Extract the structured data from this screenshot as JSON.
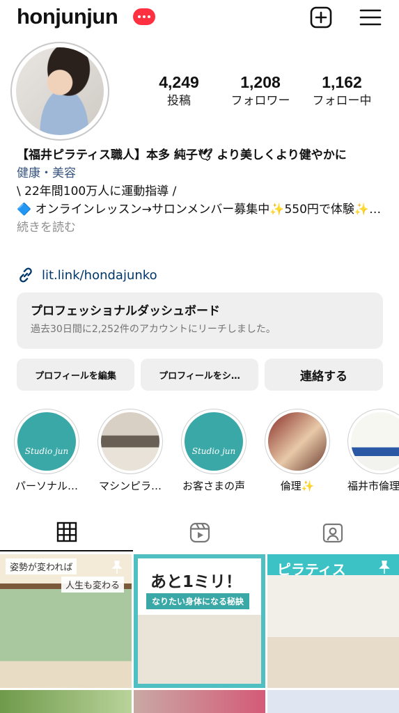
{
  "header": {
    "username": "honjunjun"
  },
  "stats": [
    {
      "value": "4,249",
      "label": "投稿"
    },
    {
      "value": "1,208",
      "label": "フォロワー"
    },
    {
      "value": "1,162",
      "label": "フォロー中"
    }
  ],
  "bio": {
    "name": "【福井ピラティス職人】本多 純子🕊 より美しくより健やかに",
    "category": "健康・美容",
    "line1": "\\ 22年間100万人に運動指導 /",
    "line2": "🔷 オンラインレッスン→サロンメンバー募集中✨550円で体験✨…",
    "more": "続きを読む"
  },
  "link": {
    "text": "lit.link/hondajunko"
  },
  "dashboard": {
    "title": "プロフェッショナルダッシュボード",
    "subtitle": "過去30日間に2,252件のアカウントにリーチしました。"
  },
  "actions": {
    "edit": "プロフィールを編集",
    "share": "プロフィールをシ…",
    "contact": "連絡する"
  },
  "highlights": [
    {
      "label": "パーソナル…",
      "studio": "Studio jun"
    },
    {
      "label": "マシンピラ…"
    },
    {
      "label": "お客さまの声",
      "studio": "Studio jun"
    },
    {
      "label": "倫理✨"
    },
    {
      "label": "福井市倫理"
    }
  ],
  "posts": [
    {
      "tag1": "姿勢が変われば",
      "tag2": "人生も変わる"
    },
    {
      "title": "あと1ミリ！",
      "subtitle": "なりたい身体になる秘訣"
    },
    {
      "title": "ピラティス"
    }
  ],
  "colors": {
    "accent_badge": "#ff3040",
    "link": "#00376b",
    "category": "#37557f",
    "teal": "#3aa8a6"
  }
}
